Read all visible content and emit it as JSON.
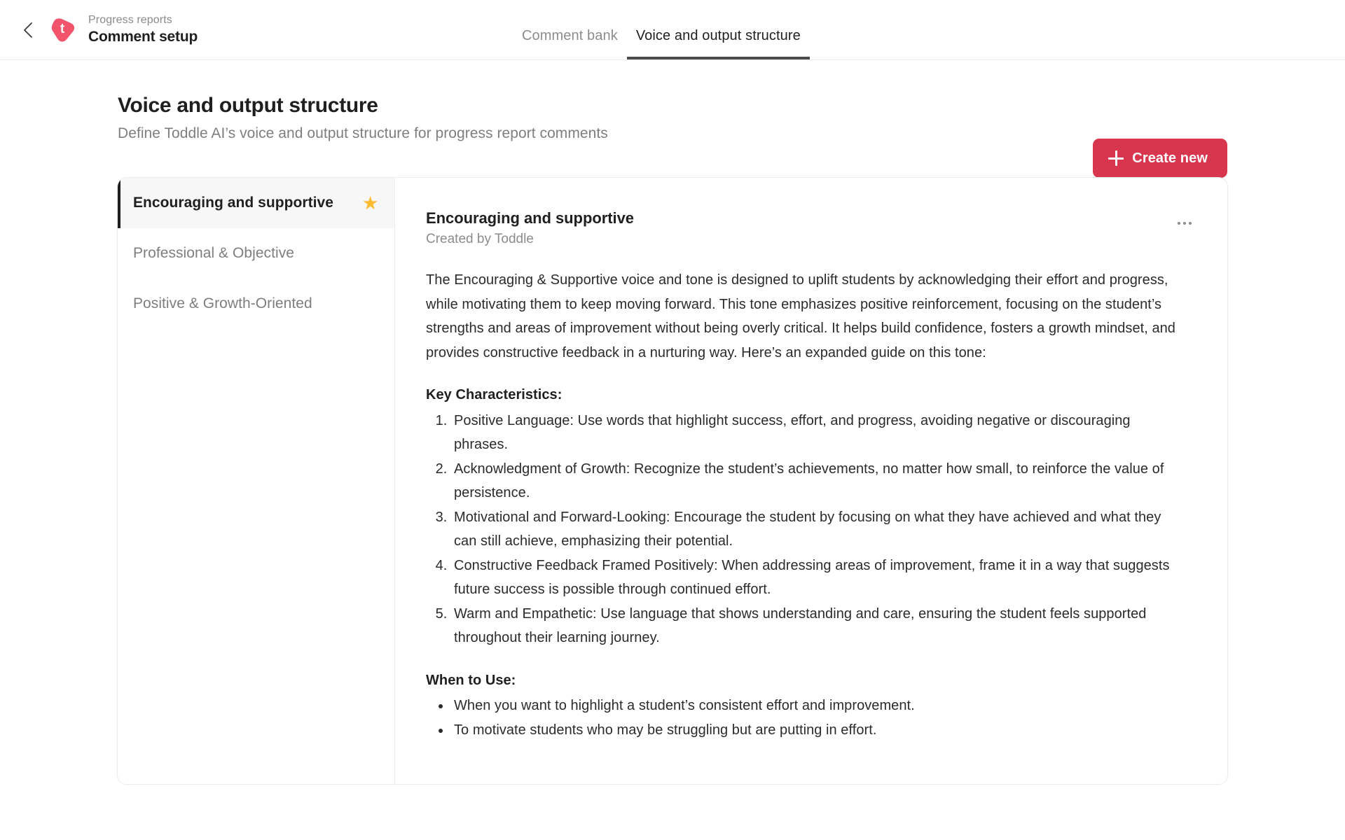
{
  "topbar": {
    "back_icon": "chevron-left-icon",
    "logo_letter": "t",
    "breadcrumb": "Progress reports",
    "title": "Comment setup",
    "tabs": [
      {
        "label": "Comment bank",
        "active": false
      },
      {
        "label": "Voice and output structure",
        "active": true
      }
    ]
  },
  "page": {
    "title": "Voice and output structure",
    "subtitle": "Define Toddle AI’s voice and output structure for progress report comments",
    "create_button": "Create new"
  },
  "tones": [
    {
      "label": "Encouraging and supportive",
      "starred": true,
      "star_glyph": "★",
      "active": true
    },
    {
      "label": "Professional & Objective",
      "starred": false,
      "star_glyph": "",
      "active": false
    },
    {
      "label": "Positive & Growth-Oriented",
      "starred": false,
      "star_glyph": "",
      "active": false
    }
  ],
  "detail": {
    "title": "Encouraging and supportive",
    "created_by": "Created by Toddle",
    "more_menu": "more-options",
    "intro": "The Encouraging & Supportive voice and tone is designed to uplift students by acknowledging their effort and progress, while motivating them to keep moving forward. This tone emphasizes positive reinforcement, focusing on the student’s strengths and areas of improvement without being overly critical. It helps build confidence, fosters a growth mindset, and provides constructive feedback in a nurturing way. Here’s an expanded guide on this tone:",
    "key_characteristics_title": "Key Characteristics:",
    "key_characteristics": [
      "Positive Language: Use words that highlight success, effort, and progress, avoiding negative or discouraging phrases.",
      "Acknowledgment of Growth: Recognize the student’s achievements, no matter how small, to reinforce the value of persistence.",
      "Motivational and Forward-Looking: Encourage the student by focusing on what they have achieved and what they can still achieve, emphasizing their potential.",
      "Constructive Feedback Framed Positively: When addressing areas of improvement, frame it in a way that suggests future success is possible through continued effort.",
      "Warm and Empathetic: Use language that shows understanding and care, ensuring the student feels supported throughout their learning journey."
    ],
    "when_to_use_title": "When to Use:",
    "when_to_use": [
      "When you want to highlight a student’s consistent effort and improvement.",
      "To motivate students who may be struggling but are putting in effort."
    ]
  },
  "colors": {
    "brand_red": "#d8364f",
    "star_yellow": "#fcba2f",
    "active_tab_underline": "#4a4a4a",
    "muted_text": "#8c8c8c"
  }
}
